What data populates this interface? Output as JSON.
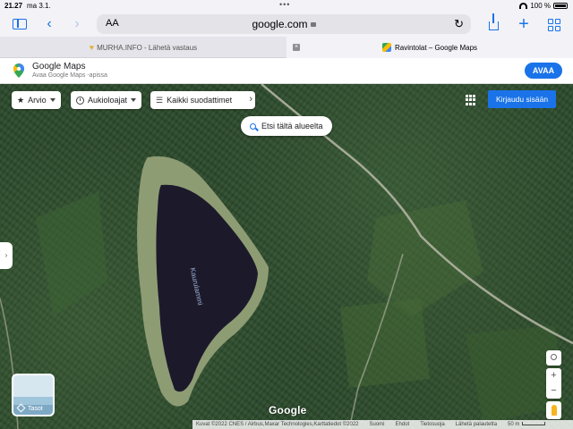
{
  "status_bar": {
    "time": "21.27",
    "date": "ma 3.1.",
    "battery": "100 %"
  },
  "browser": {
    "text_size_label": "AA",
    "url": "google.com",
    "tabs": [
      {
        "label": "MURHA.INFO - Lähetä vastaus"
      },
      {
        "label": "Ravintolat – Google Maps"
      }
    ]
  },
  "app_banner": {
    "title": "Google Maps",
    "subtitle": "Avaa Google Maps -apissa",
    "open_label": "AVAA"
  },
  "map": {
    "filters": {
      "rating_label": "Arvio",
      "open_now_label": "Aukioloajat",
      "all_filters_label": "Kaikki suodattimet"
    },
    "sign_in_label": "Kirjaudu sisään",
    "search_area_label": "Etsi tältä alueelta",
    "lake_label": "Kaurulammi",
    "layers_label": "Tasot",
    "google_logo": "Google",
    "footer": {
      "attribution": "Kuvat ©2022 CNES / Airbus,Maxar Technologies,Karttatiedot ©2022",
      "country": "Suomi",
      "terms": "Ehdot",
      "privacy": "Tietosuoja",
      "feedback": "Lähetä palautetta",
      "scale": "50 m"
    }
  },
  "colors": {
    "accent": "#1a73e8",
    "forest": "#2c4a2c",
    "lake": "#1c1a2a"
  }
}
